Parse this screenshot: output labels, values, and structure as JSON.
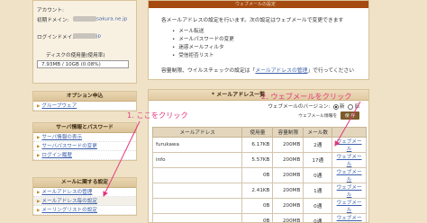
{
  "sidebar": {
    "account": {
      "account_label": "アカウント:",
      "domain_label": "初期ドメイン:",
      "domain_value": "sakura.ne.jp",
      "login_label": "ログインドメイン:",
      "login_value": "jp",
      "disk_label": "ディスクの使用量(使用率)",
      "disk_value": "7.93MB / 10GB (0.08%)",
      "disk_percent": 0.08
    },
    "options": {
      "title": "オプション申込",
      "items": [
        "グループウェア"
      ]
    },
    "server": {
      "title": "サーバ情報とパスワード",
      "items": [
        "サーバ情報の表示",
        "サーバパスワードの変更",
        "ログイン履歴"
      ]
    },
    "mail": {
      "title": "メールに関する設定",
      "items": [
        "メールアドレスの管理",
        "メールアドレス毎の設定",
        "メーリングリストの設定"
      ]
    }
  },
  "main": {
    "info_top": "ウェブメールの設定",
    "intro": "各メールアドレスの設定を行います。次の設定はウェブメールで変更できます",
    "features": [
      "メール転送",
      "メールパスワードの変更",
      "迷惑メールフィルタ",
      "受信拒否リスト"
    ],
    "note_prefix": "容量制限、ウイルスチェックの設定は「",
    "note_link": "メールアドレスの管理",
    "note_suffix": "」で行ってください",
    "panel_title": "* メールアドレス一覧",
    "version_label": "ウェブメールのバージョン:",
    "version_new": "新",
    "version_old": "旧",
    "save_hint": "ウェブメール情報を",
    "save_button": "保 存",
    "table": {
      "headers": [
        "メールアドレス",
        "使用量",
        "容量制限",
        "メール数",
        ""
      ],
      "rows": [
        {
          "address": "furukawa",
          "used": "6.17KB",
          "limit": "200MB",
          "count": "2通",
          "action": "ウェブメール"
        },
        {
          "address": "info",
          "used": "5.57KB",
          "limit": "200MB",
          "count": "17通",
          "action": "ウェブメール"
        },
        {
          "address": "",
          "used": "0B",
          "limit": "200MB",
          "count": "0通",
          "action": "ウェブメール"
        },
        {
          "address": "",
          "used": "2.41KB",
          "limit": "200MB",
          "count": "1通",
          "action": "ウェブメール"
        },
        {
          "address": "",
          "used": "0B",
          "limit": "200MB",
          "count": "0通",
          "action": "ウェブメール"
        },
        {
          "address": "",
          "used": "0B",
          "limit": "200MB",
          "count": "0通",
          "action": "ウェブメール"
        }
      ]
    }
  },
  "annotations": {
    "step1": "1. ここをクリック",
    "step2": "2. ウェブメールをクリック",
    "color": "#e2377c"
  }
}
